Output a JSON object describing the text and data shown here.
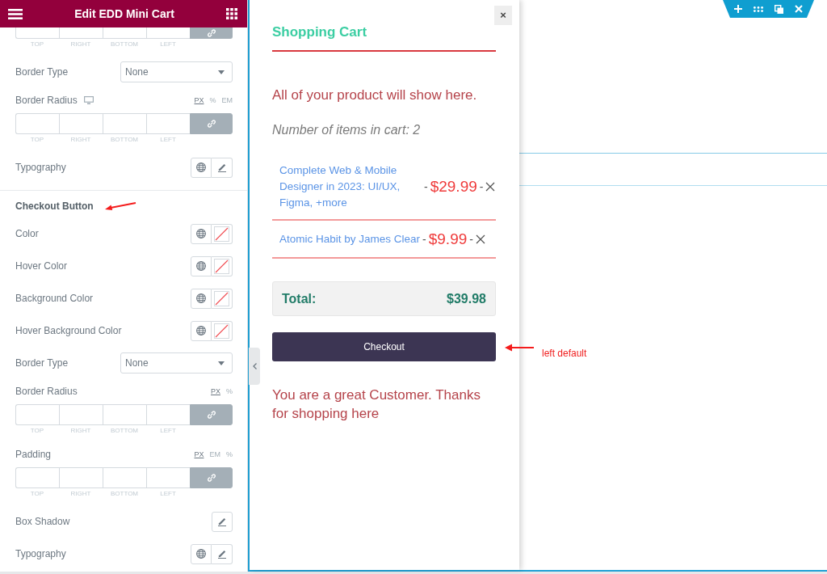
{
  "panel": {
    "title": "Edit EDD Mini Cart",
    "controls": [
      {
        "kind": "dimensions",
        "partial": true,
        "linked": true,
        "sides": [
          "TOP",
          "RIGHT",
          "BOTTOM",
          "LEFT"
        ]
      },
      {
        "kind": "select",
        "label": "Border Type",
        "value": "None"
      },
      {
        "kind": "dimensions",
        "label": "Border Radius",
        "responsive": true,
        "units": [
          {
            "label": "PX",
            "selected": true
          },
          {
            "label": "%",
            "selected": false
          },
          {
            "label": "EM",
            "selected": false
          }
        ],
        "linked": true,
        "sides": [
          "TOP",
          "RIGHT",
          "BOTTOM",
          "LEFT"
        ]
      },
      {
        "kind": "popover",
        "label": "Typography",
        "global": true
      },
      {
        "kind": "heading",
        "label": "Checkout Button",
        "annotation_arrow": true
      },
      {
        "kind": "color",
        "label": "Color"
      },
      {
        "kind": "color",
        "label": "Hover Color"
      },
      {
        "kind": "color",
        "label": "Background Color"
      },
      {
        "kind": "color",
        "label": "Hover Background Color"
      },
      {
        "kind": "select",
        "label": "Border Type",
        "value": "None"
      },
      {
        "kind": "dimensions",
        "label": "Border Radius",
        "units": [
          {
            "label": "PX",
            "selected": true
          },
          {
            "label": "%",
            "selected": false
          }
        ],
        "linked": true,
        "sides": [
          "TOP",
          "RIGHT",
          "BOTTOM",
          "LEFT"
        ]
      },
      {
        "kind": "dimensions",
        "label": "Padding",
        "units": [
          {
            "label": "PX",
            "selected": true
          },
          {
            "label": "EM",
            "selected": false
          },
          {
            "label": "%",
            "selected": false
          }
        ],
        "linked": true,
        "sides": [
          "TOP",
          "RIGHT",
          "BOTTOM",
          "LEFT"
        ]
      },
      {
        "kind": "popover",
        "label": "Box Shadow",
        "global": false
      },
      {
        "kind": "popover",
        "label": "Typography",
        "global": true
      }
    ]
  },
  "cart": {
    "close": "×",
    "title": "Shopping Cart",
    "intro": "All of your product will show here.",
    "count": "Number of items in cart: 2",
    "items": [
      {
        "name": "Complete Web & Mobile Designer in 2023: UI/UX, Figma, +more",
        "before_price": "-",
        "price": "$29.99",
        "before_remove": "-"
      },
      {
        "name": "Atomic Habit by James Clear",
        "before_price": "-",
        "price": "$9.99",
        "before_remove": "-"
      }
    ],
    "total": {
      "label": "Total:",
      "amount": "$39.98"
    },
    "checkout": "Checkout",
    "outro": "You are a great Customer. Thanks for shopping here"
  },
  "annotation": {
    "text": "left default"
  }
}
